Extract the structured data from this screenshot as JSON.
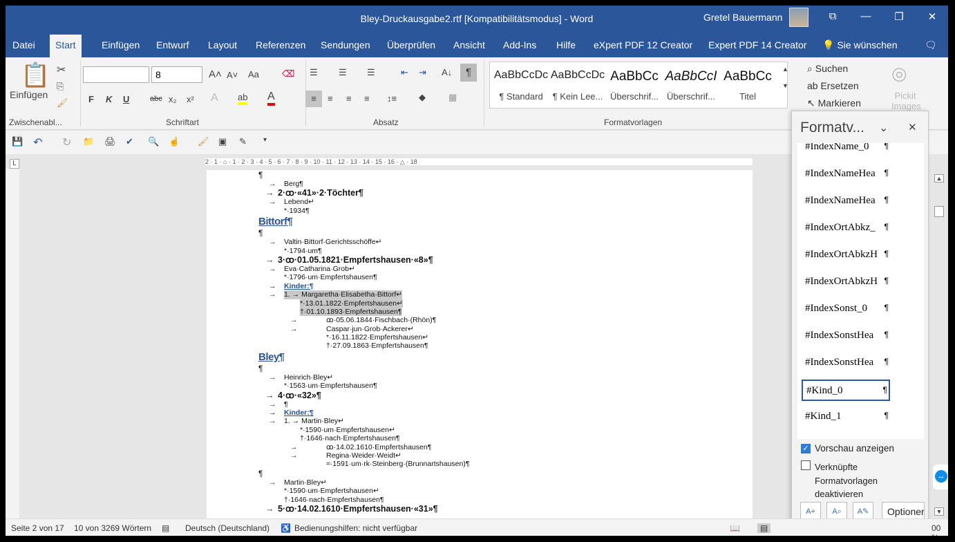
{
  "window": {
    "title": "Bley-Druckausgabe2.rtf [Kompatibilitätsmodus]  -  Word",
    "user": "Gretel Bauermann"
  },
  "tabs": [
    "Datei",
    "Start",
    "Einfügen",
    "Entwurf",
    "Layout",
    "Referenzen",
    "Sendungen",
    "Überprüfen",
    "Ansicht",
    "Add-Ins",
    "Hilfe",
    "eXpert PDF 12 Creator",
    "Expert PDF 14 Creator"
  ],
  "tell_me": "Sie wünschen",
  "ribbon": {
    "paste": "Einfügen",
    "clipboard_group": "Zwischenabl...",
    "font_group": "Schriftart",
    "paragraph_group": "Absatz",
    "styles_group": "Formatvorlagen",
    "font_name": "",
    "font_size": "8",
    "bold": "F",
    "italic": "K",
    "underline": "U",
    "strike": "abc",
    "sub": "x₂",
    "sup": "x²",
    "case": "Aa",
    "styles": [
      {
        "preview": "AaBbCcDc",
        "name": "¶ Standard"
      },
      {
        "preview": "AaBbCcDc",
        "name": "¶ Kein Lee..."
      },
      {
        "preview": "AaBbCc",
        "name": "Überschrif..."
      },
      {
        "preview": "AaBbCcI",
        "name": "Überschrif..."
      },
      {
        "preview": "AaBbCc",
        "name": "Titel"
      }
    ],
    "find": "Suchen",
    "replace": "Ersetzen",
    "select": "Markieren",
    "pickit": "Pickit Images"
  },
  "ruler": "2 · 1 · ⌂ · 1 · 2 · 3 · 4 · 5 · 6 · 7 · 8 · 9 · 10 · 11 · 12 · 13 · 14 · 15 · 16 · △ · 18",
  "document": {
    "lines": [
      {
        "k": "para",
        "t": "¶"
      },
      {
        "k": "person",
        "t": "Berg¶"
      },
      {
        "k": "marriage",
        "t": "2·ꝏ·«41»·2·Töchter¶"
      },
      {
        "k": "person",
        "t": "Lebend↵"
      },
      {
        "k": "detail",
        "t": "*·1934¶"
      },
      {
        "k": "heading",
        "t": "Bittorf¶"
      },
      {
        "k": "para",
        "t": "¶"
      },
      {
        "k": "person",
        "t": "Valtin·Bittorf·Gerichtsschöffe↵"
      },
      {
        "k": "detail",
        "t": "*·1794·um¶"
      },
      {
        "k": "marriage",
        "t": "3·ꝏ·01.05.1821·Empfertshausen·«8»¶"
      },
      {
        "k": "person",
        "t": "Eva·Catharina·Grob↵"
      },
      {
        "k": "detail",
        "t": "*·1796·um·Empfertshausen¶"
      },
      {
        "k": "kinder",
        "t": "Kinder:¶"
      },
      {
        "k": "child",
        "t": "1. → Margaretha·Elisabetha·Bittorf↵",
        "sel": true
      },
      {
        "k": "cdetail",
        "t": "*·13.01.1822·Empfertshausen↵",
        "sel": true
      },
      {
        "k": "cdetail",
        "t": "†·01.10.1893·Empfertshausen¶",
        "sel": true
      },
      {
        "k": "spouse",
        "t": "ꝏ·05.06.1844·Fischbach·(Rhön)¶"
      },
      {
        "k": "spouse",
        "t": "Caspar·jun·Grob·Ackerer↵"
      },
      {
        "k": "sdetail",
        "t": "*·16.11.1822·Empfertshausen↵"
      },
      {
        "k": "sdetail",
        "t": "†·27.09.1863·Empfertshausen¶"
      },
      {
        "k": "heading",
        "t": "Bley¶"
      },
      {
        "k": "para",
        "t": "¶"
      },
      {
        "k": "person",
        "t": "Heinrich·Bley↵"
      },
      {
        "k": "detail",
        "t": "*·1563·um·Empfertshausen¶"
      },
      {
        "k": "marriage",
        "t": "4·ꝏ·«32»¶"
      },
      {
        "k": "person",
        "t": "¶"
      },
      {
        "k": "kinder",
        "t": "Kinder:¶"
      },
      {
        "k": "child",
        "t": "1. → Martin·Bley↵"
      },
      {
        "k": "cdetail",
        "t": "*·1590·um·Empfertshausen↵"
      },
      {
        "k": "cdetail",
        "t": "†·1646·nach·Empfertshausen¶"
      },
      {
        "k": "spouse",
        "t": "ꝏ·14.02.1610·Empfertshausen¶"
      },
      {
        "k": "spouse",
        "t": "Regina·Weider·Weidt↵"
      },
      {
        "k": "sdetail",
        "t": "≈·1591·um·rk·Steinberg·(Brunnartshausen)¶"
      },
      {
        "k": "para",
        "t": "¶"
      },
      {
        "k": "person",
        "t": "Martin·Bley↵"
      },
      {
        "k": "detail",
        "t": "*·1590·um·Empfertshausen↵"
      },
      {
        "k": "detail",
        "t": "†·1646·nach·Empfertshausen¶"
      },
      {
        "k": "marriage",
        "t": "5·ꝏ·14.02.1610·Empfertshausen·«31»¶"
      }
    ]
  },
  "styles_pane": {
    "title": "Formatv...",
    "items": [
      "#IndexName_0",
      "#IndexNameHea",
      "#IndexNameHea",
      "#IndexOrtAbkz_",
      "#IndexOrtAbkzH",
      "#IndexOrtAbkzH",
      "#IndexSonst_0",
      "#IndexSonstHea",
      "#IndexSonstHea",
      "#Kind_0",
      "#Kind_1"
    ],
    "selected": "#Kind_0",
    "preview_label": "Vorschau anzeigen",
    "preview_checked": true,
    "linked_label_1": "Verknüpfte",
    "linked_label_2": "Formatvorlagen",
    "linked_label_3": "deaktivieren",
    "linked_checked": false,
    "options": "Optionen"
  },
  "status": {
    "page": "Seite 2 von 17",
    "words": "10 von 3269 Wörtern",
    "language": "Deutsch (Deutschland)",
    "accessibility": "Bedienungshilfen: nicht verfügbar",
    "zoom": "00 %"
  },
  "colors": {
    "brand": "#2b579a"
  }
}
